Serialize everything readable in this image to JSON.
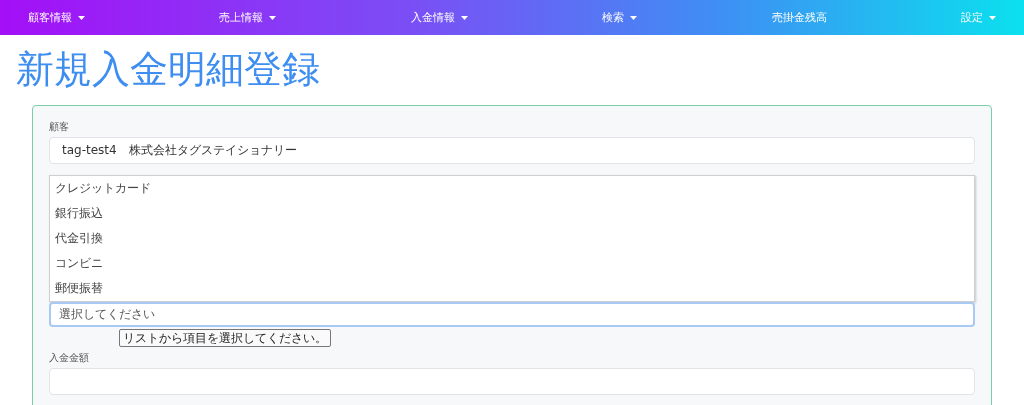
{
  "nav": [
    {
      "label": "顧客情報",
      "dropdown": true
    },
    {
      "label": "売上情報",
      "dropdown": true
    },
    {
      "label": "入金情報",
      "dropdown": true
    },
    {
      "label": "検索",
      "dropdown": true
    },
    {
      "label": "売掛金残高",
      "dropdown": false
    },
    {
      "label": "設定",
      "dropdown": true
    }
  ],
  "title": "新規入金明細登録",
  "customer": {
    "label": "顧客",
    "value": "tag-test4　株式会社タグステイショナリー"
  },
  "payment_options": [
    "クレジットカード",
    "銀行振込",
    "代金引換",
    "コンビニ",
    "郵便振替"
  ],
  "payment_field": {
    "placeholder": "選択してください",
    "tooltip": "リストから項目を選択してください。"
  },
  "amount": {
    "label": "入金金額"
  }
}
